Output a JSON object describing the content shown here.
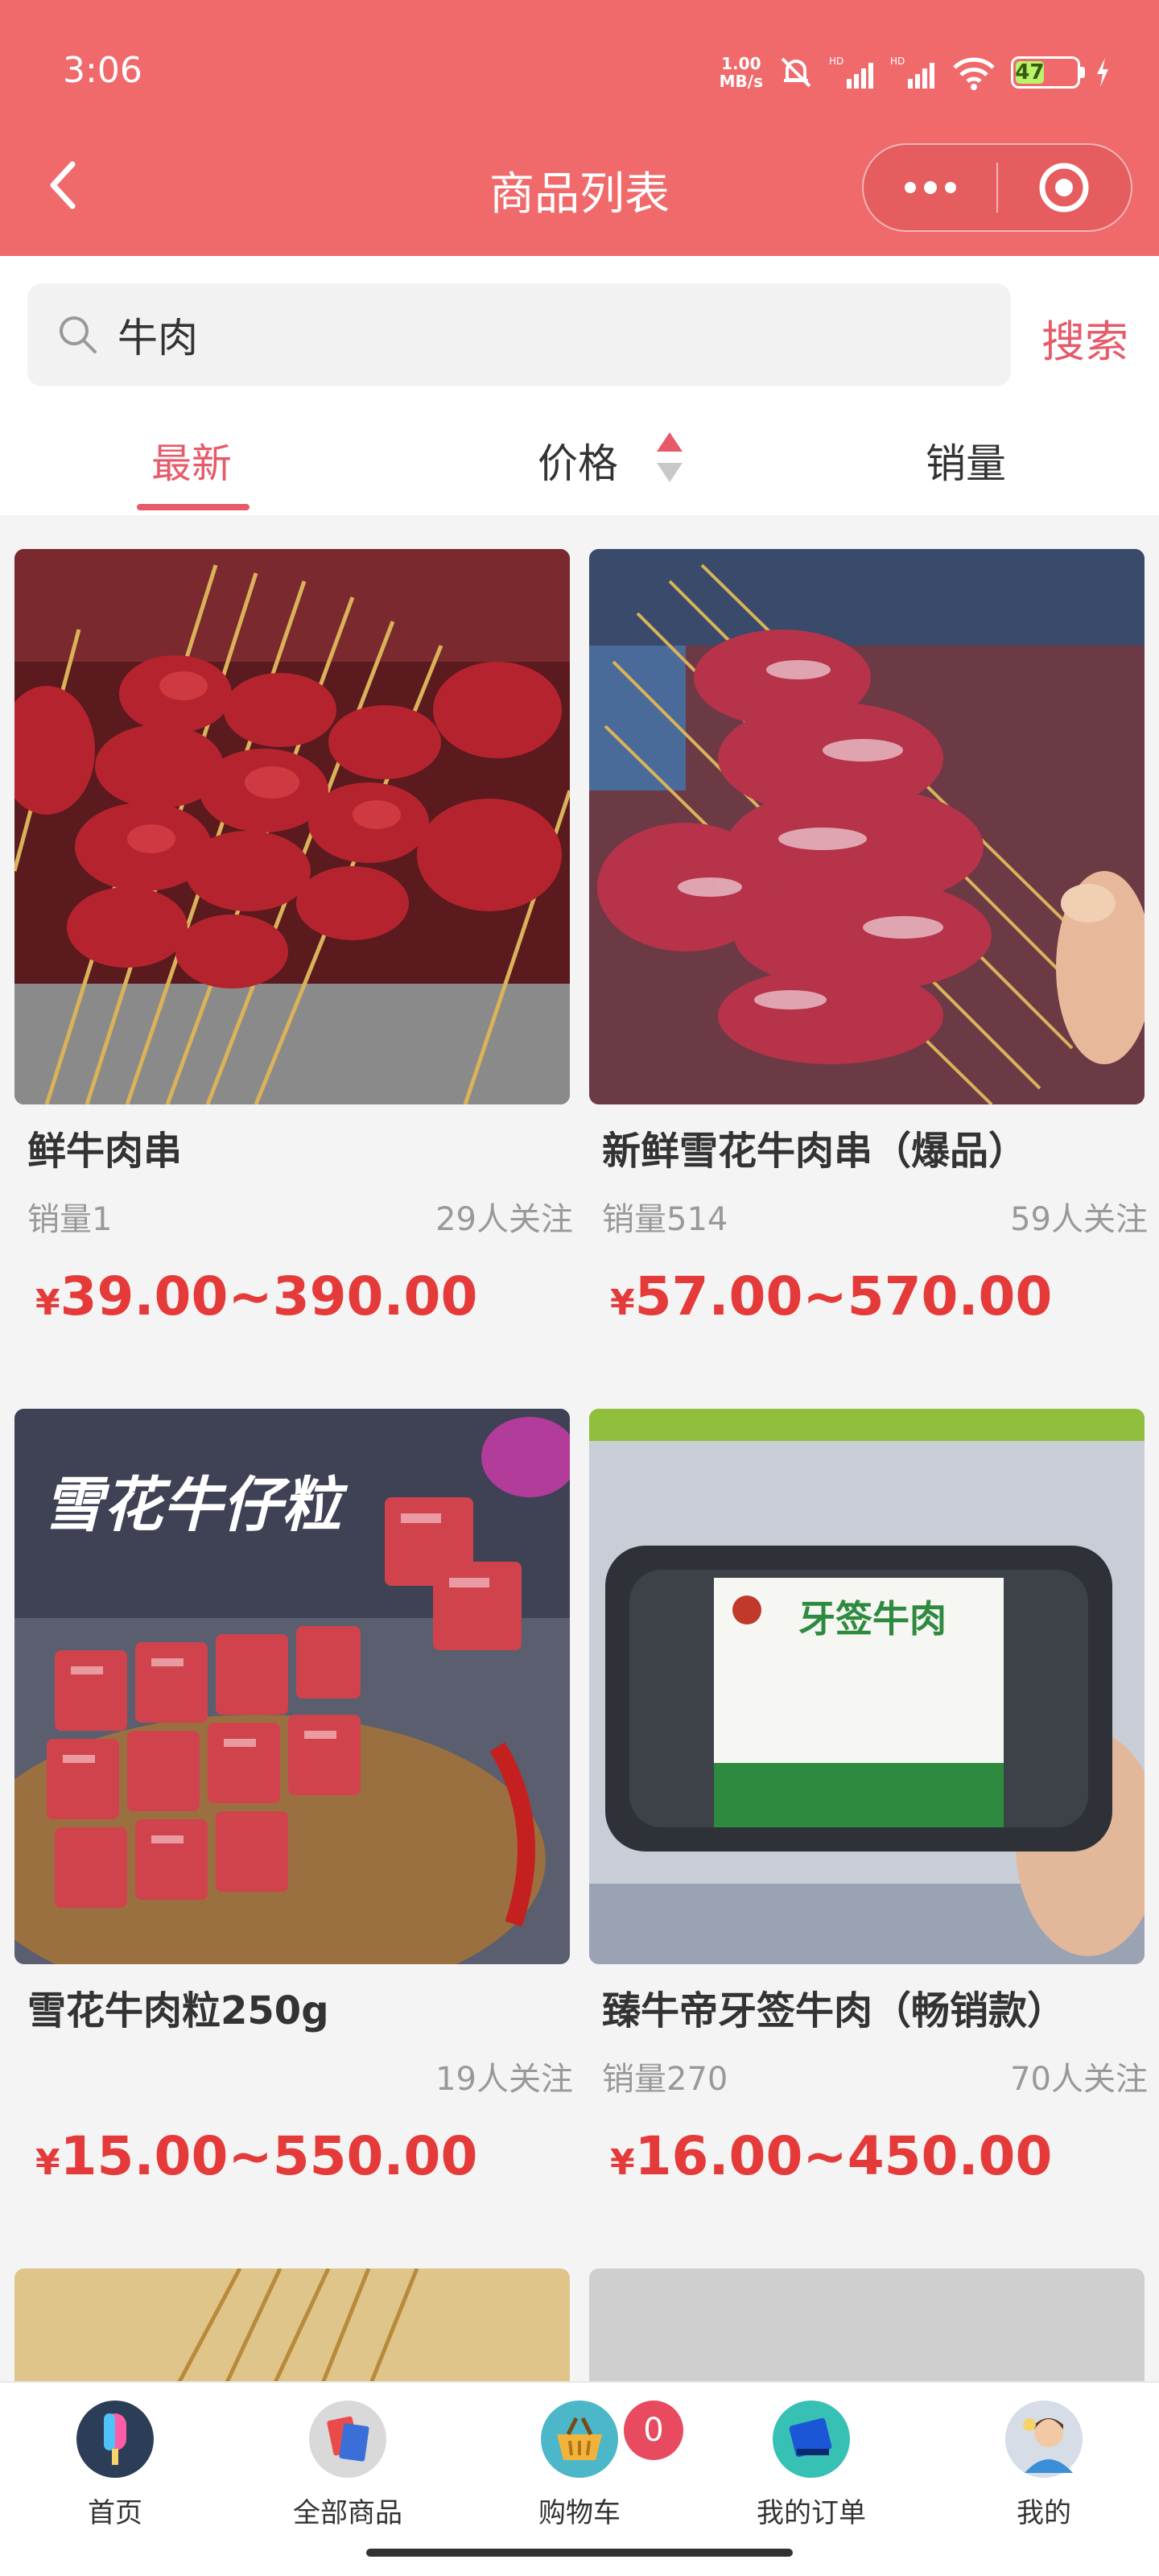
{
  "status": {
    "time": "3:06",
    "net_speed_value": "1.00",
    "net_speed_unit": "MB/s",
    "battery": "47",
    "battery_level": 0.47
  },
  "nav": {
    "title": "商品列表"
  },
  "search": {
    "value": "牛肉",
    "button_label": "搜索"
  },
  "sort_tabs": [
    {
      "label": "最新",
      "active": true
    },
    {
      "label": "价格",
      "active": false
    },
    {
      "label": "销量",
      "active": false
    }
  ],
  "products": [
    {
      "title": "鲜牛肉串",
      "sales": "销量1",
      "followers": "29人关注",
      "currency": "¥",
      "price": "39.00~390.00"
    },
    {
      "title": "新鲜雪花牛肉串（爆品）",
      "sales": "销量514",
      "followers": "59人关注",
      "currency": "¥",
      "price": "57.00~570.00"
    },
    {
      "title": "雪花牛肉粒250g",
      "sales": "",
      "followers": "19人关注",
      "currency": "¥",
      "price": "15.00~550.00",
      "image_text": "雪花牛仔粒"
    },
    {
      "title": "臻牛帝牙签牛肉（畅销款）",
      "sales": "销量270",
      "followers": "70人关注",
      "currency": "¥",
      "price": "16.00~450.00",
      "image_text": "牙签牛肉"
    }
  ],
  "tabbar": {
    "items": [
      {
        "label": "首页",
        "icon": "popsicle-icon"
      },
      {
        "label": "全部商品",
        "icon": "all-products-icon"
      },
      {
        "label": "购物车",
        "icon": "basket-icon"
      },
      {
        "label": "我的订单",
        "icon": "orders-icon"
      },
      {
        "label": "我的",
        "icon": "profile-avatar-icon"
      }
    ],
    "cart_count": "0"
  },
  "colors": {
    "brand": "#f06a6c",
    "accent": "#e65a6a",
    "price": "#e53a3a"
  }
}
